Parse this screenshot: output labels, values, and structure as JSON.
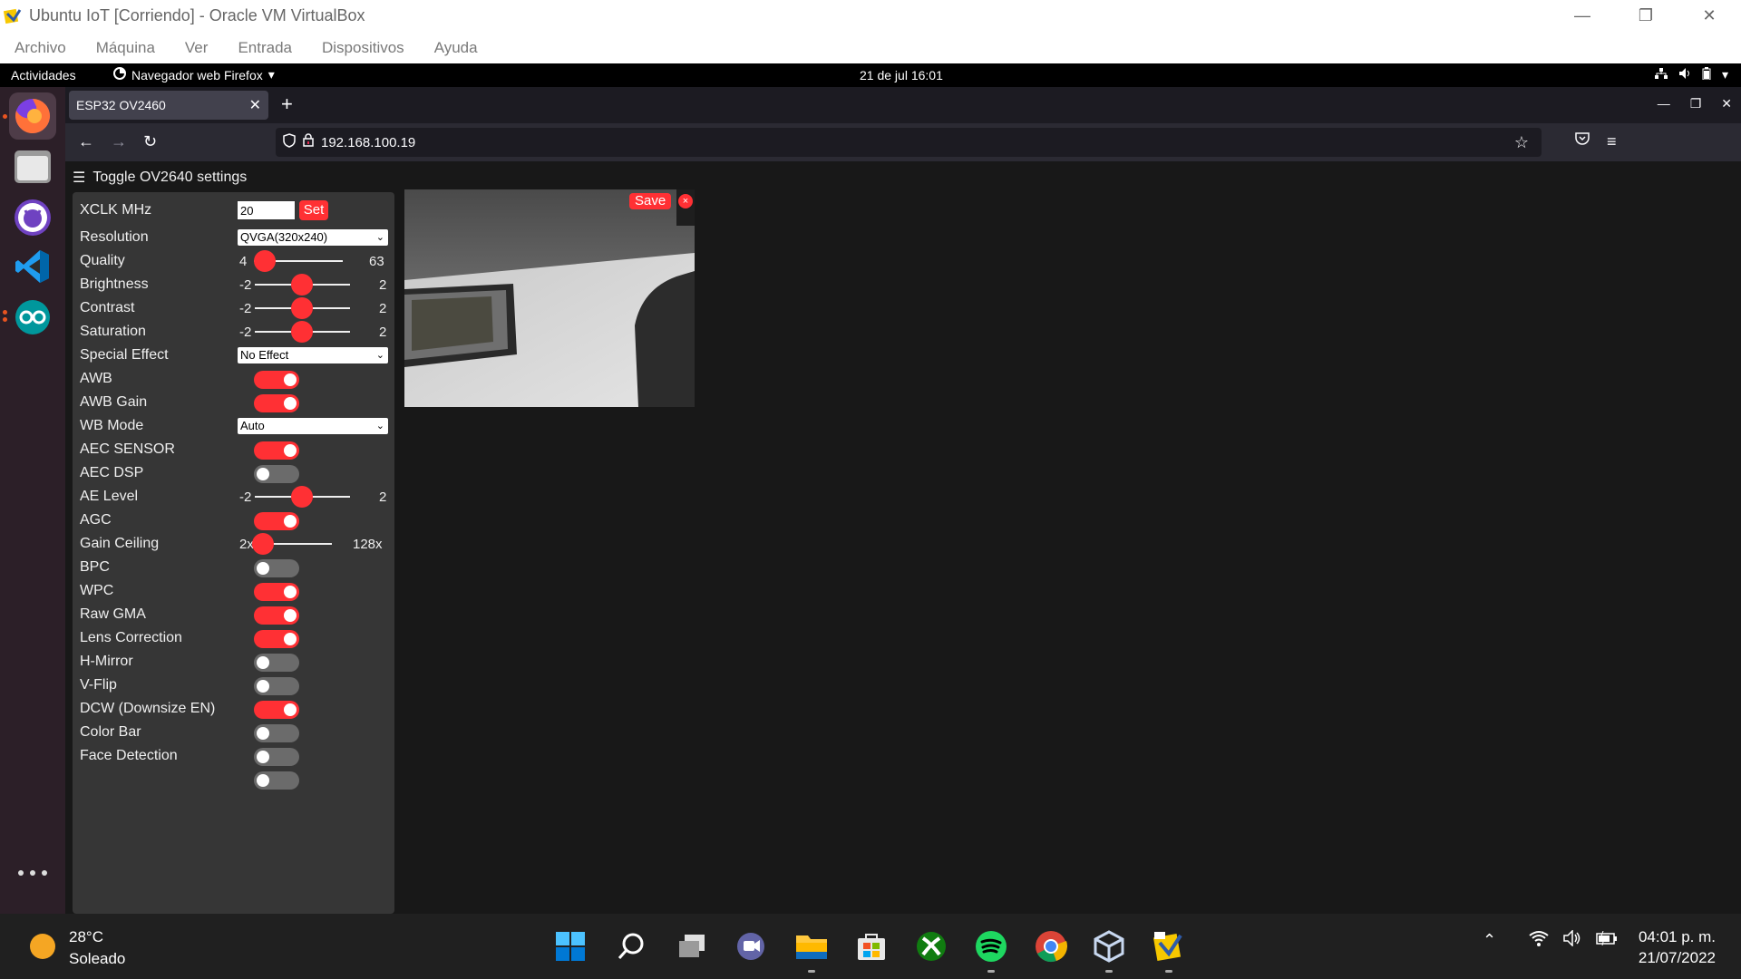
{
  "vbox": {
    "title": "Ubuntu IoT [Corriendo] - Oracle VM VirtualBox",
    "menu": [
      "Archivo",
      "Máquina",
      "Ver",
      "Entrada",
      "Dispositivos",
      "Ayuda"
    ],
    "controls": [
      "minimize-icon",
      "restore-icon",
      "close-icon"
    ]
  },
  "gnome": {
    "activities": "Actividades",
    "app_menu": "Navegador web Firefox",
    "clock": "21 de jul  16:01",
    "tray": [
      "network-icon",
      "volume-icon",
      "battery-icon",
      "chevron-down-icon"
    ]
  },
  "dock": {
    "items": [
      "firefox-icon",
      "files-icon",
      "github-desktop-icon",
      "vscode-icon",
      "arduino-icon"
    ]
  },
  "firefox": {
    "tab_title": "ESP32 OV2460",
    "url": "192.168.100.19"
  },
  "camera": {
    "toggle_label": "Toggle OV2640 settings",
    "save_label": "Save",
    "close_label": "×",
    "xclk": {
      "label": "XCLK MHz",
      "value": "20",
      "button": "Set"
    },
    "resolution": {
      "label": "Resolution",
      "value": "QVGA(320x240)"
    },
    "quality": {
      "label": "Quality",
      "min": "4",
      "max": "63",
      "value": 10
    },
    "brightness": {
      "label": "Brightness",
      "min": "-2",
      "max": "2",
      "value": 0
    },
    "contrast": {
      "label": "Contrast",
      "min": "-2",
      "max": "2",
      "value": 0
    },
    "saturation": {
      "label": "Saturation",
      "min": "-2",
      "max": "2",
      "value": 0
    },
    "special_effect": {
      "label": "Special Effect",
      "value": "No Effect"
    },
    "awb": {
      "label": "AWB",
      "on": true
    },
    "awb_gain": {
      "label": "AWB Gain",
      "on": true
    },
    "wb_mode": {
      "label": "WB Mode",
      "value": "Auto"
    },
    "aec_sensor": {
      "label": "AEC SENSOR",
      "on": true
    },
    "aec_dsp": {
      "label": "AEC DSP",
      "on": false
    },
    "ae_level": {
      "label": "AE Level",
      "min": "-2",
      "max": "2",
      "value": 0
    },
    "agc": {
      "label": "AGC",
      "on": true
    },
    "gain_ceiling": {
      "label": "Gain Ceiling",
      "min": "2x",
      "max": "128x",
      "value": 0
    },
    "bpc": {
      "label": "BPC",
      "on": false
    },
    "wpc": {
      "label": "WPC",
      "on": true
    },
    "raw_gma": {
      "label": "Raw GMA",
      "on": true
    },
    "lens_correction": {
      "label": "Lens Correction",
      "on": true
    },
    "h_mirror": {
      "label": "H-Mirror",
      "on": false
    },
    "v_flip": {
      "label": "V-Flip",
      "on": false
    },
    "dcw": {
      "label": "DCW (Downsize EN)",
      "on": true
    },
    "color_bar": {
      "label": "Color Bar",
      "on": false
    },
    "face_detection": {
      "label": "Face Detection",
      "on": false
    }
  },
  "taskbar": {
    "weather_temp": "28°C",
    "weather_desc": "Soleado",
    "apps": [
      "windows-start-icon",
      "search-icon",
      "task-view-icon",
      "teams-chat-icon",
      "file-explorer-icon",
      "microsoft-store-icon",
      "xbox-icon",
      "spotify-icon",
      "chrome-icon",
      "virtualbox-vm-icon",
      "virtualbox-icon"
    ],
    "time": "04:01 p. m.",
    "date": "21/07/2022"
  },
  "colors": {
    "accent": "#ff3034",
    "panel": "#363636",
    "page_bg": "#181818"
  }
}
